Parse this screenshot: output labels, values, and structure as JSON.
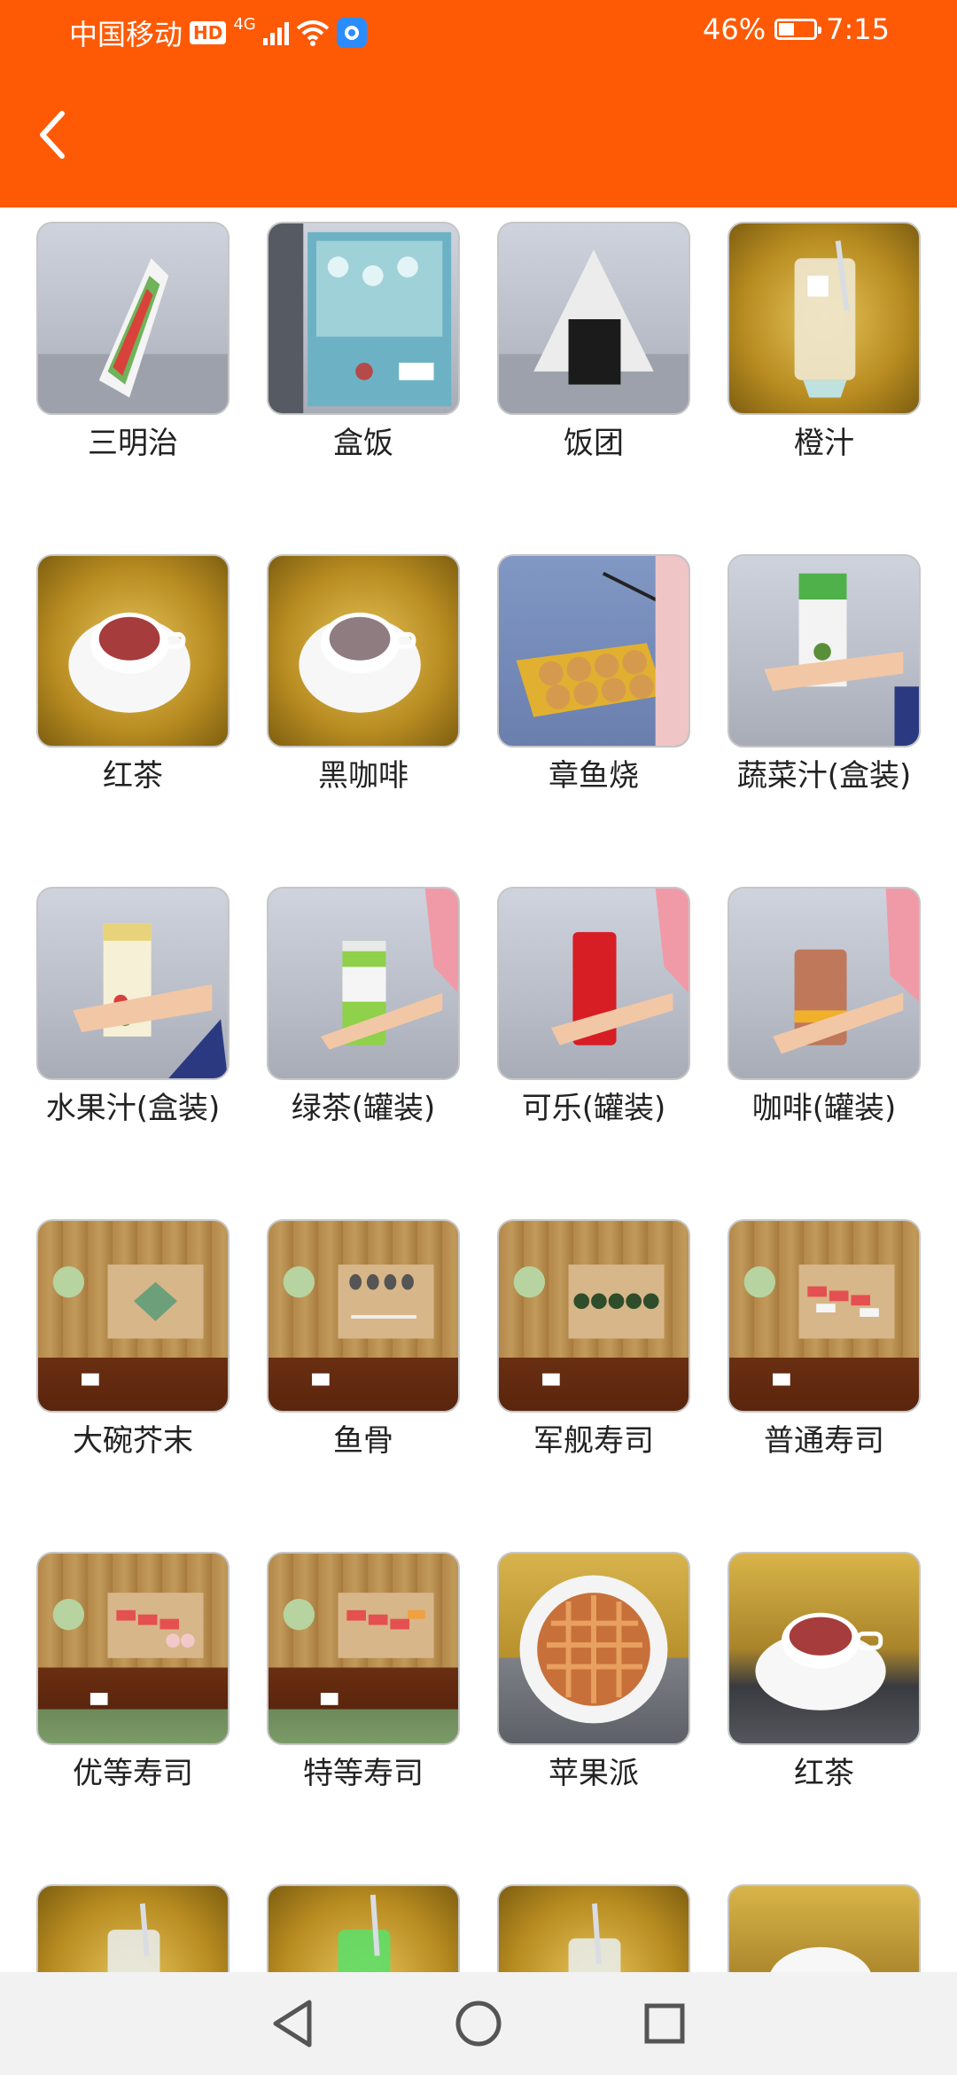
{
  "status_bar": {
    "carrier": "中国移动",
    "hd": "HD",
    "network": "4G",
    "battery": "46%",
    "battery_level": 0.46,
    "time": "7:15"
  },
  "colors": {
    "accent": "#fe5a06"
  },
  "items": [
    {
      "label": "三明治",
      "thumb": "sandwich"
    },
    {
      "label": "盒饭",
      "thumb": "bento"
    },
    {
      "label": "饭团",
      "thumb": "onigiri"
    },
    {
      "label": "橙汁",
      "thumb": "juice-glass"
    },
    {
      "label": "红茶",
      "thumb": "tea-cup"
    },
    {
      "label": "黑咖啡",
      "thumb": "coffee-cup"
    },
    {
      "label": "章鱼烧",
      "thumb": "takoyaki"
    },
    {
      "label": "蔬菜汁(盒装)",
      "thumb": "carton-green"
    },
    {
      "label": "水果汁(盒装)",
      "thumb": "carton-fruit"
    },
    {
      "label": "绿茶(罐装)",
      "thumb": "can-green"
    },
    {
      "label": "可乐(罐装)",
      "thumb": "can-red"
    },
    {
      "label": "咖啡(罐装)",
      "thumb": "can-brown"
    },
    {
      "label": "大碗芥末",
      "thumb": "wasabi"
    },
    {
      "label": "鱼骨",
      "thumb": "fishbone"
    },
    {
      "label": "军舰寿司",
      "thumb": "gunkan"
    },
    {
      "label": "普通寿司",
      "thumb": "sushi-normal"
    },
    {
      "label": "优等寿司",
      "thumb": "sushi-good"
    },
    {
      "label": "特等寿司",
      "thumb": "sushi-premium"
    },
    {
      "label": "苹果派",
      "thumb": "apple-pie"
    },
    {
      "label": "红茶",
      "thumb": "tea-cup-2"
    },
    {
      "label": "",
      "thumb": "drink-1"
    },
    {
      "label": "",
      "thumb": "drink-2"
    },
    {
      "label": "",
      "thumb": "drink-3"
    },
    {
      "label": "",
      "thumb": "drink-4"
    }
  ]
}
